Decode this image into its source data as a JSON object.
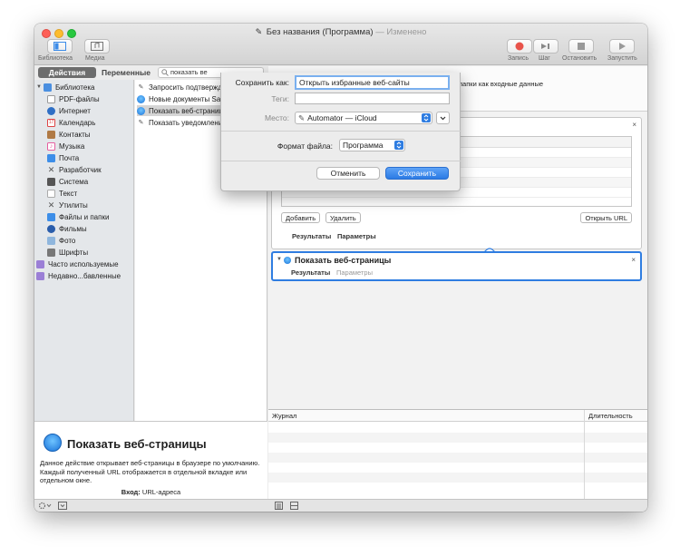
{
  "window": {
    "title": "Без названия (Программа)",
    "title_suffix": "— Изменено"
  },
  "toolbar": {
    "library_label": "Библиотека",
    "media_label": "Медиа",
    "record_label": "Запись",
    "step_label": "Шаг",
    "stop_label": "Остановить",
    "run_label": "Запустить"
  },
  "tabs": {
    "actions": "Действия",
    "variables": "Переменные"
  },
  "search": {
    "value": "показать ве"
  },
  "library": {
    "root": "Библиотека",
    "items": [
      "PDF-файлы",
      "Интернет",
      "Календарь",
      "Контакты",
      "Музыка",
      "Почта",
      "Разработчик",
      "Система",
      "Текст",
      "Утилиты",
      "Файлы и папки",
      "Фильмы",
      "Фото",
      "Шрифты"
    ],
    "frequent": "Часто используемые",
    "recent": "Недавно...бавленные"
  },
  "actions": {
    "items": [
      "Запросить подтверждение",
      "Новые документы Safari",
      "Показать веб-страницы",
      "Показать уведомление"
    ],
    "selected_index": 2
  },
  "description": {
    "title": "Показать веб-страницы",
    "text": "Данное действие открывает веб-страницы в браузере по умолчанию. Каждый полученный URL отображается в отдельной вкладке или отдельном окне.",
    "input_label": "Вход:",
    "input_value": "URL-адреса"
  },
  "workflow": {
    "top_hint": "папки как входные данные",
    "card1": {
      "add_button": "Добавить",
      "delete_button": "Удалить",
      "open_url_button": "Открыть URL",
      "results": "Результаты",
      "options": "Параметры"
    },
    "card2": {
      "title": "Показать веб-страницы",
      "results": "Результаты",
      "options": "Параметры"
    }
  },
  "log": {
    "journal_header": "Журнал",
    "duration_header": "Длительность"
  },
  "save_sheet": {
    "save_as_label": "Сохранить как:",
    "save_as_value": "Открыть избранные веб-сайты",
    "tags_label": "Теги:",
    "tags_value": "",
    "location_label": "Место:",
    "location_value": "Automator — iCloud",
    "format_label": "Формат файла:",
    "format_value": "Программа",
    "cancel_button": "Отменить",
    "save_button": "Сохранить"
  },
  "colors": {
    "accent": "#2f7de1",
    "close": "#fd5f57",
    "minimize": "#fdbc2e",
    "zoom": "#28c840",
    "record": "#e8534a"
  }
}
